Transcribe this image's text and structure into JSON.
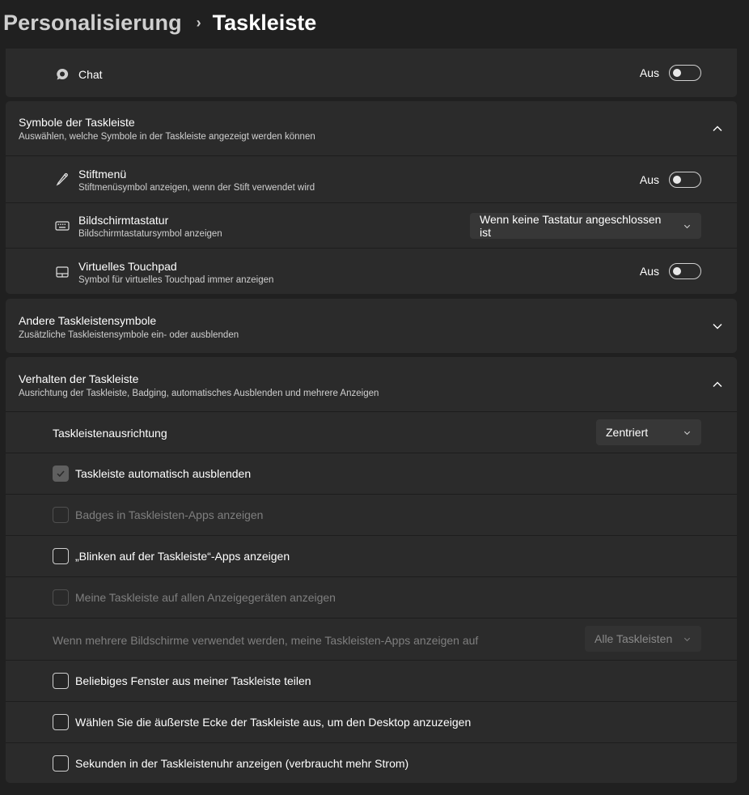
{
  "breadcrumb": {
    "parent": "Personalisierung",
    "separator": "›",
    "current": "Taskleiste"
  },
  "chat": {
    "label": "Chat",
    "state": "Aus",
    "icon": "chat-icon"
  },
  "symbole": {
    "title": "Symbole der Taskleiste",
    "desc": "Auswählen, welche Symbole in der Taskleiste angezeigt werden können",
    "items": [
      {
        "title": "Stiftmenü",
        "desc": "Stiftmenüsymbol anzeigen, wenn der Stift verwendet wird",
        "state": "Aus",
        "icon": "pen-icon"
      },
      {
        "title": "Bildschirmtastatur",
        "desc": "Bildschirmtastatursymbol anzeigen",
        "dropdown": "Wenn keine Tastatur angeschlossen ist",
        "icon": "keyboard-icon"
      },
      {
        "title": "Virtuelles Touchpad",
        "desc": "Symbol für virtuelles Touchpad immer anzeigen",
        "state": "Aus",
        "icon": "touchpad-icon"
      }
    ]
  },
  "andere": {
    "title": "Andere Taskleistensymbole",
    "desc": "Zusätzliche Taskleistensymbole ein- oder ausblenden"
  },
  "verhalten": {
    "title": "Verhalten der Taskleiste",
    "desc": "Ausrichtung der Taskleiste, Badging, automatisches Ausblenden und mehrere Anzeigen",
    "alignment_label": "Taskleistenausrichtung",
    "alignment_value": "Zentriert",
    "autohide": "Taskleiste automatisch ausblenden",
    "badges": "Badges in Taskleisten-Apps anzeigen",
    "flash": "„Blinken auf der Taskleiste“-Apps anzeigen",
    "all_displays": "Meine Taskleiste auf allen Anzeigegeräten anzeigen",
    "multi_label": "Wenn mehrere Bildschirme verwendet werden, meine Taskleisten-Apps anzeigen auf",
    "multi_value": "Alle Taskleisten",
    "share_window": "Beliebiges Fenster aus meiner Taskleiste teilen",
    "far_corner": "Wählen Sie die äußerste Ecke der Taskleiste aus, um den Desktop anzuzeigen",
    "seconds": "Sekunden in der Taskleistenuhr anzeigen (verbraucht mehr Strom)"
  },
  "colors": {
    "background": "#202020",
    "card": "#2b2b2b",
    "divider": "#1d1d1d",
    "dropdown": "#373737"
  }
}
